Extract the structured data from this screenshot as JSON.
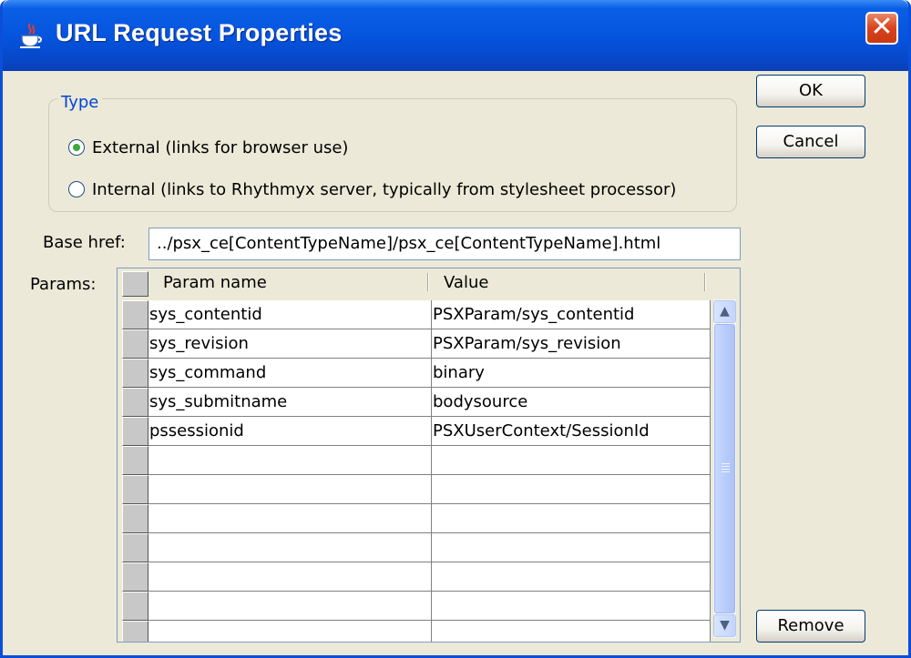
{
  "window": {
    "title": "URL Request Properties",
    "close_glyph": "✕"
  },
  "icons": {
    "app": "java-coffee-icon",
    "close": "close-icon",
    "scroll_up": "chevron-up-icon",
    "scroll_down": "chevron-down-icon",
    "grip": "scroll-grip-icon"
  },
  "type_group": {
    "label": "Type",
    "options": [
      {
        "label": "External (links for browser use)",
        "selected": true
      },
      {
        "label": "Internal (links to Rhythmyx server, typically from stylesheet processor)",
        "selected": false
      }
    ]
  },
  "base_href": {
    "label": "Base href:",
    "value": "../psx_ce[ContentTypeName]/psx_ce[ContentTypeName].html"
  },
  "params": {
    "label": "Params:",
    "columns": [
      "Param name",
      "Value"
    ],
    "rows": [
      {
        "name": "sys_contentid",
        "value": "PSXParam/sys_contentid"
      },
      {
        "name": "sys_revision",
        "value": "PSXParam/sys_revision"
      },
      {
        "name": "sys_command",
        "value": "binary"
      },
      {
        "name": "sys_submitname",
        "value": "bodysource"
      },
      {
        "name": "pssessionid",
        "value": "PSXUserContext/SessionId"
      },
      {
        "name": "",
        "value": ""
      },
      {
        "name": "",
        "value": ""
      },
      {
        "name": "",
        "value": ""
      },
      {
        "name": "",
        "value": ""
      },
      {
        "name": "",
        "value": ""
      },
      {
        "name": "",
        "value": ""
      },
      {
        "name": "",
        "value": ""
      }
    ]
  },
  "buttons": {
    "ok": "OK",
    "cancel": "Cancel",
    "remove": "Remove"
  },
  "colors": {
    "titlebar": "#0553dd",
    "group_label": "#0046d5",
    "dialog_bg": "#ece9d8",
    "close": "#d9421c"
  }
}
